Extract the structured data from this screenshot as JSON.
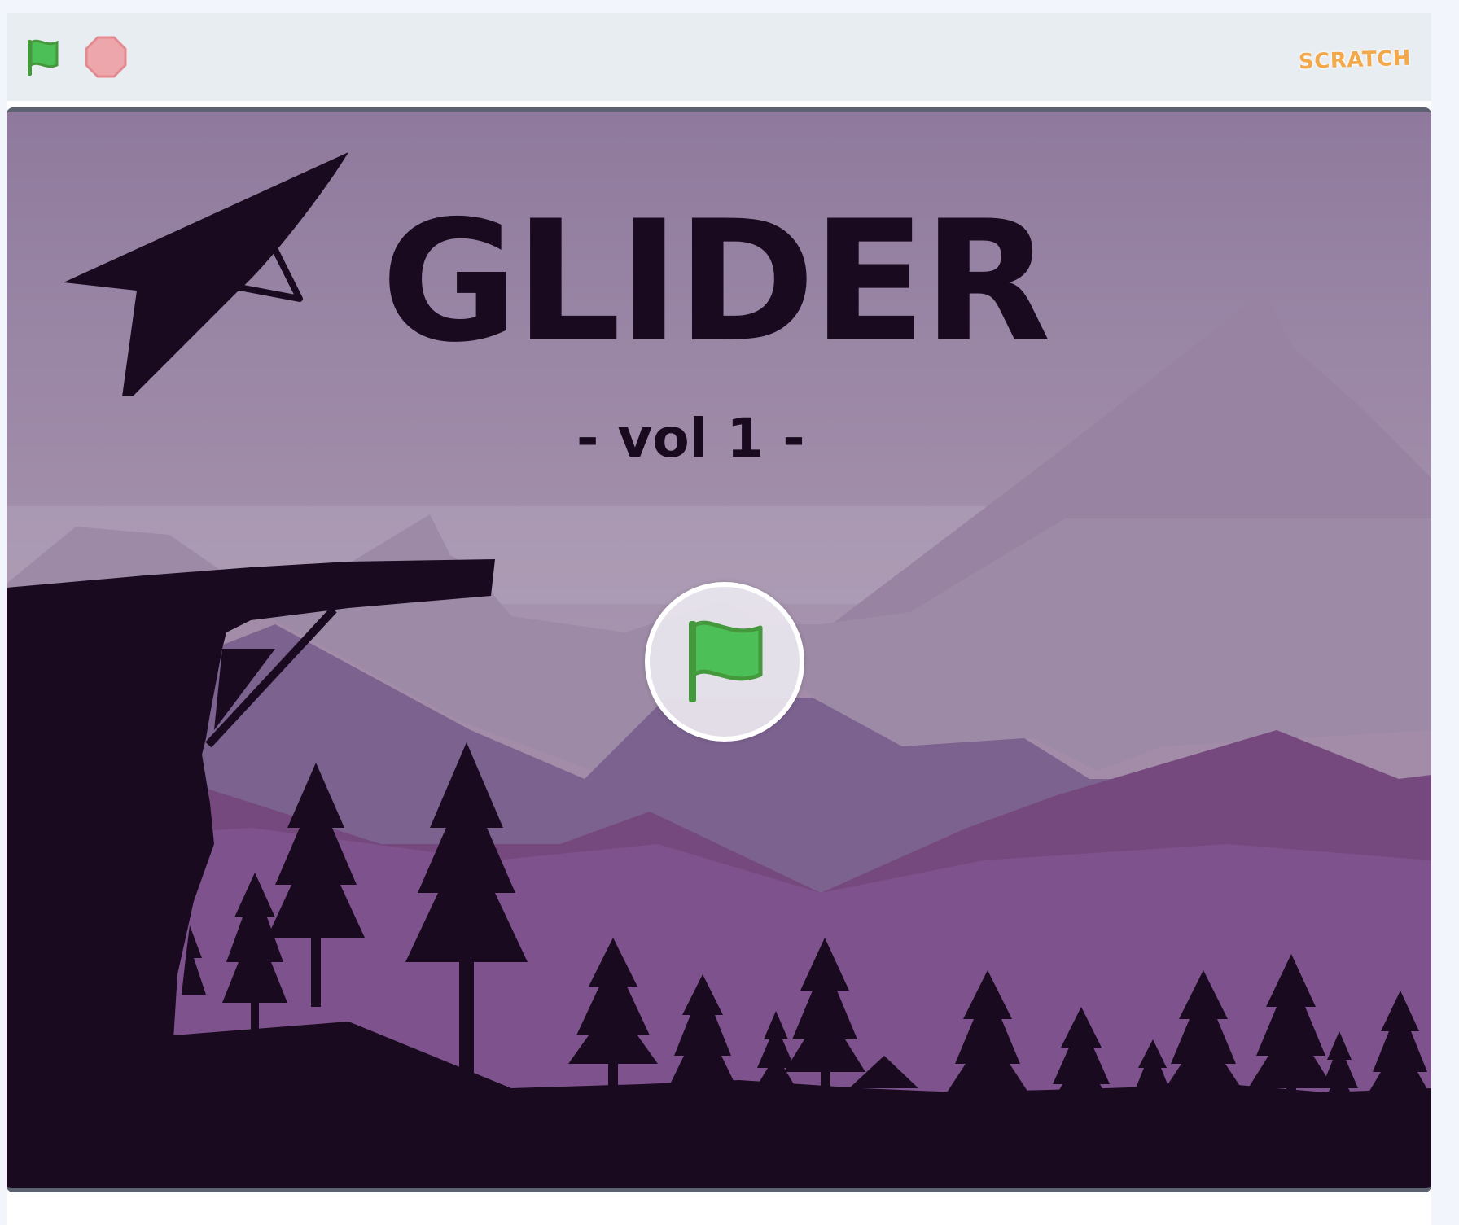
{
  "controls": {
    "green_flag": "green-flag-icon",
    "stop": "stop-sign-icon",
    "logo_text": "SCRATCH"
  },
  "stage": {
    "title": "GLIDER",
    "subtitle": "- vol 1 -",
    "start_overlay": "green-flag-icon"
  },
  "colors": {
    "flag_green": "#4cbf56",
    "stop_red": "#eda6ab",
    "silhouette": "#190a1f",
    "sky": "#927e9f",
    "logo_orange": "#f3a94b"
  }
}
